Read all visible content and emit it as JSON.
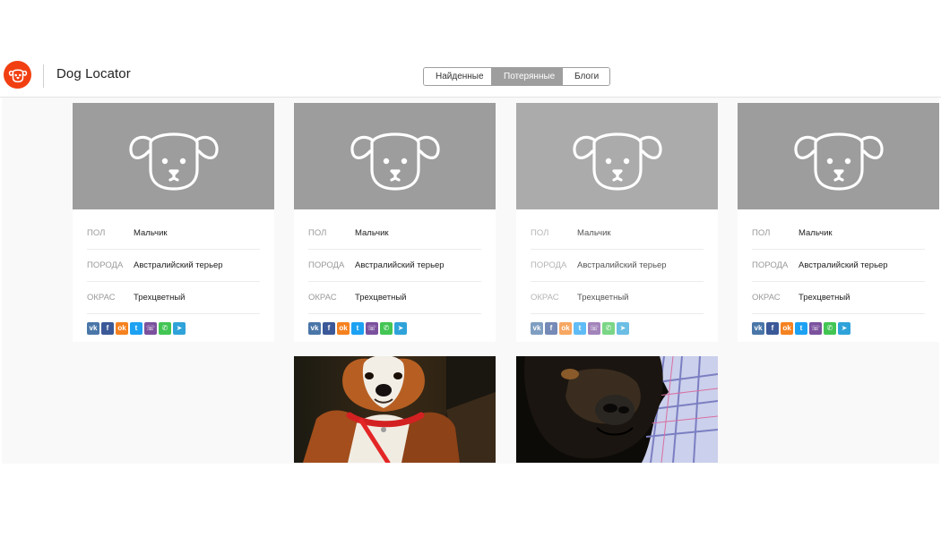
{
  "header": {
    "title": "Dog Locator",
    "tabs": [
      {
        "label": "Найденные",
        "active": false
      },
      {
        "label": "Потерянные",
        "active": true
      },
      {
        "label": "Блоги",
        "active": false
      }
    ]
  },
  "colors": {
    "brand": "#f13f12",
    "placeholder_bg": "#9d9d9d",
    "vk": "#4a76a8",
    "facebook": "#3b5998",
    "odnoklassniki": "#f58220",
    "twitter": "#1da1f2",
    "viber": "#7b519d",
    "whatsapp": "#43c554",
    "telegram": "#2fa3d9"
  },
  "cards": [
    {
      "fields": [
        {
          "label": "ПОЛ",
          "value": "Мальчик"
        },
        {
          "label": "ПОРОДА",
          "value": "Австралийский терьер"
        },
        {
          "label": "ОКРАС",
          "value": "Трехцветный"
        }
      ],
      "social": [
        "vk-icon",
        "facebook-icon",
        "odnoklassniki-icon",
        "twitter-icon",
        "viber-icon",
        "whatsapp-icon",
        "telegram-icon"
      ]
    },
    {
      "fields": [
        {
          "label": "ПОЛ",
          "value": "Мальчик"
        },
        {
          "label": "ПОРОДА",
          "value": "Австралийский терьер"
        },
        {
          "label": "ОКРАС",
          "value": "Трехцветный"
        }
      ],
      "social": [
        "vk-icon",
        "facebook-icon",
        "odnoklassniki-icon",
        "twitter-icon",
        "viber-icon",
        "whatsapp-icon",
        "telegram-icon"
      ]
    },
    {
      "fields": [
        {
          "label": "ПОЛ",
          "value": "Мальчик"
        },
        {
          "label": "ПОРОДА",
          "value": "Австралийский терьер"
        },
        {
          "label": "ОКРАС",
          "value": "Трехцветный"
        }
      ],
      "social": [
        "vk-icon",
        "facebook-icon",
        "odnoklassniki-icon",
        "twitter-icon",
        "viber-icon",
        "whatsapp-icon",
        "telegram-icon"
      ]
    },
    {
      "fields": [
        {
          "label": "ПОЛ",
          "value": "Мальчик"
        },
        {
          "label": "ПОРОДА",
          "value": "Австралийский терьер"
        },
        {
          "label": "ОКРАС",
          "value": "Трехцветный"
        }
      ],
      "social": [
        "vk-icon",
        "facebook-icon",
        "odnoklassniki-icon",
        "twitter-icon",
        "viber-icon",
        "whatsapp-icon",
        "telegram-icon"
      ]
    }
  ]
}
